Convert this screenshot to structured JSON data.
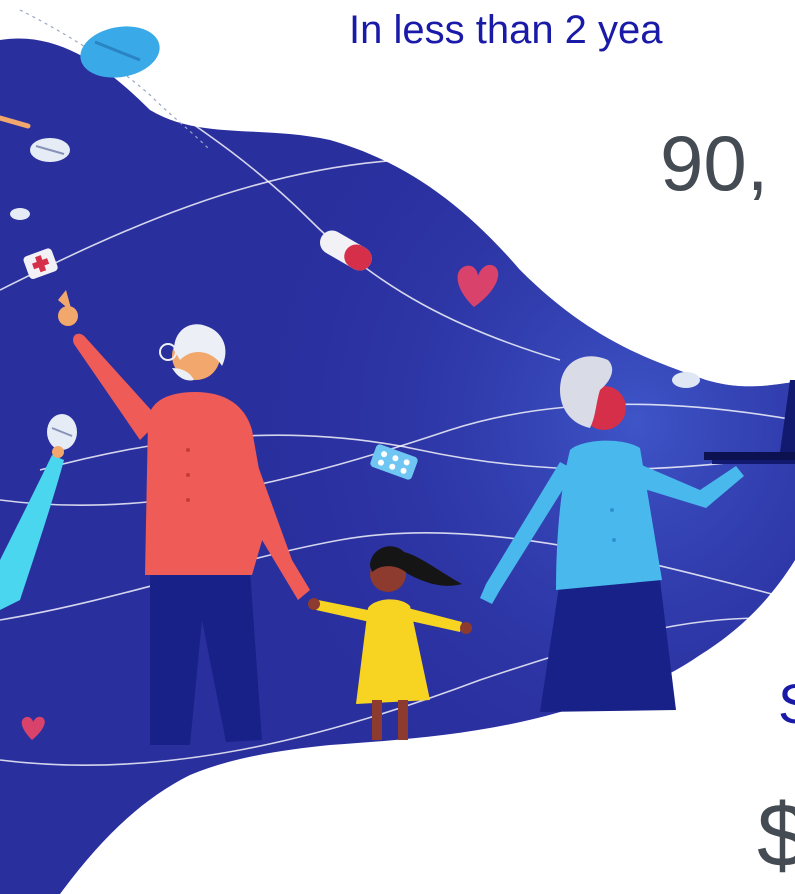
{
  "headline": "In less than 2 yea",
  "stat_primary": "90,",
  "stat_secondary_label": "S",
  "stat_tertiary": "$",
  "colors": {
    "headline_text": "#1a1aa8",
    "stat_text": "#444b52",
    "wave_background": "#2a2f9e",
    "grandpa_shirt": "#ef5b57",
    "grandma_shirt": "#49b8ec",
    "girl_dress": "#f6d421",
    "trousers": "#172187"
  },
  "illustration": {
    "subject": "family-walking-holding-hands",
    "icons": [
      "pill-icon",
      "capsule-icon",
      "medical-kit-icon",
      "heart-icon",
      "laptop-icon"
    ]
  }
}
